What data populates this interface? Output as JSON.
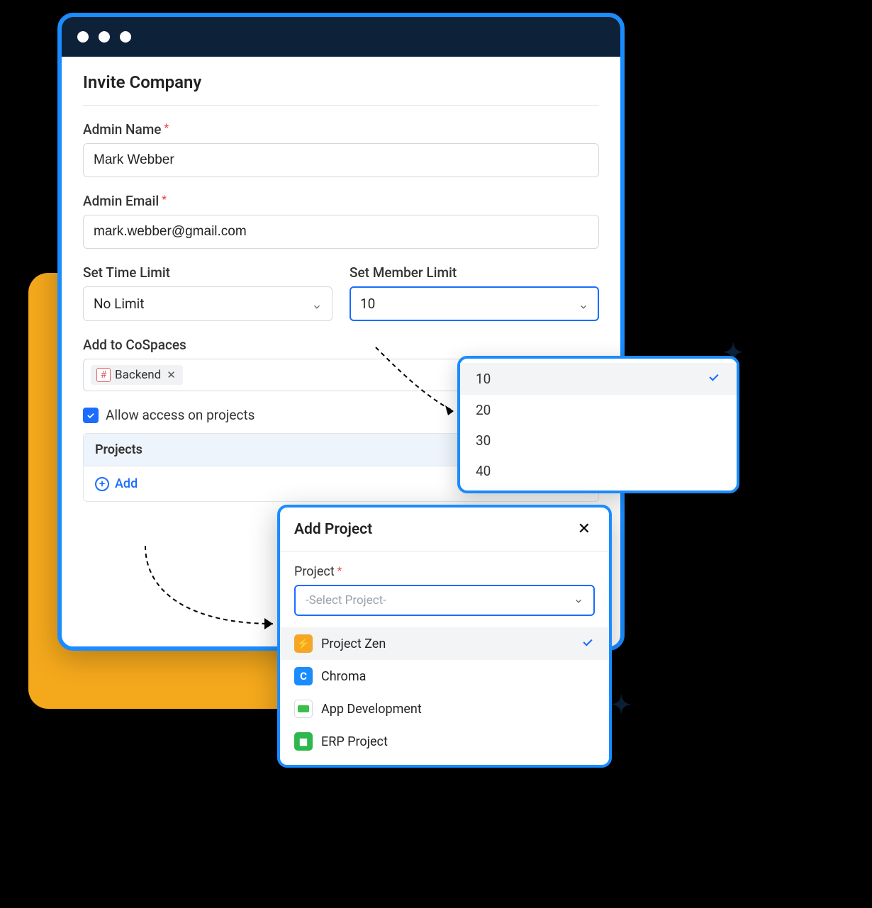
{
  "modal": {
    "title": "Invite Company",
    "admin_name_label": "Admin Name",
    "admin_name_value": "Mark Webber",
    "admin_email_label": "Admin Email",
    "admin_email_value": "mark.webber@gmail.com",
    "time_limit_label": "Set Time Limit",
    "time_limit_value": "No Limit",
    "member_limit_label": "Set Member Limit",
    "member_limit_value": "10",
    "cospaces_label": "Add to CoSpaces",
    "cospaces_chip": "Backend",
    "allow_access_label": "Allow access on projects",
    "projects_header": "Projects",
    "add_label": "Add"
  },
  "member_limit_options": [
    {
      "label": "10",
      "selected": true
    },
    {
      "label": "20",
      "selected": false
    },
    {
      "label": "30",
      "selected": false
    },
    {
      "label": "40",
      "selected": false
    }
  ],
  "project_modal": {
    "title": "Add Project",
    "field_label": "Project",
    "placeholder": "-Select Project-",
    "options": [
      {
        "label": "Project Zen",
        "icon_color": "orange",
        "icon_glyph": "⚡",
        "selected": true
      },
      {
        "label": "Chroma",
        "icon_color": "blue",
        "icon_glyph": "C",
        "selected": false
      },
      {
        "label": "App Development",
        "icon_color": "white",
        "icon_glyph": "",
        "selected": false
      },
      {
        "label": "ERP Project",
        "icon_color": "green",
        "icon_glyph": "◼",
        "selected": false
      }
    ]
  }
}
